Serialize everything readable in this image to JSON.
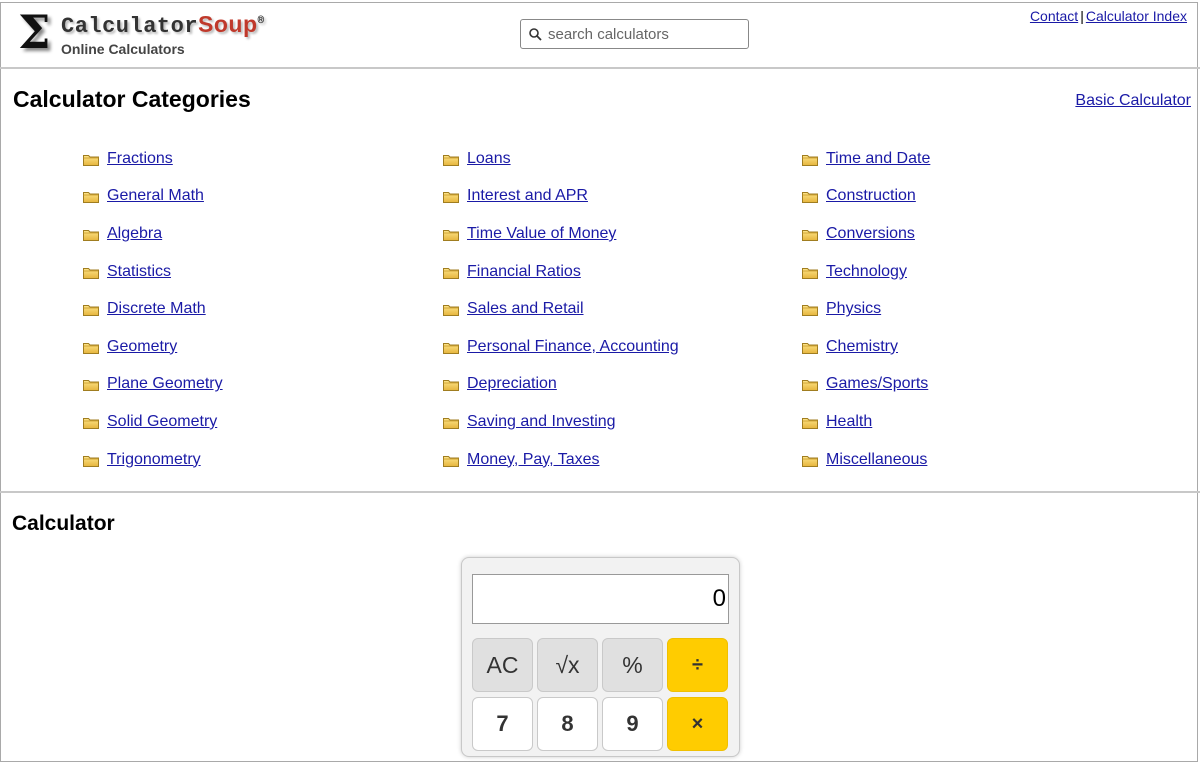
{
  "header": {
    "logo_name": "Calculator",
    "logo_soup": "Soup",
    "logo_reg": "®",
    "tagline": "Online Calculators",
    "search_placeholder": "search calculators",
    "contact": "Contact",
    "separator": "|",
    "index": "Calculator Index"
  },
  "categories": {
    "title": "Calculator Categories",
    "basic_link": "Basic Calculator",
    "columns": [
      [
        "Fractions",
        "General Math",
        "Algebra",
        "Statistics",
        "Discrete Math",
        "Geometry",
        "Plane Geometry",
        "Solid Geometry",
        "Trigonometry"
      ],
      [
        "Loans",
        "Interest and APR",
        "Time Value of Money",
        "Financial Ratios",
        "Sales and Retail",
        "Personal Finance, Accounting",
        "Depreciation",
        "Saving and Investing",
        "Money, Pay, Taxes"
      ],
      [
        "Time and Date",
        "Construction",
        "Conversions",
        "Technology",
        "Physics",
        "Chemistry",
        "Games/Sports",
        "Health",
        "Miscellaneous"
      ]
    ],
    "folder_icon": "folder-icon"
  },
  "calculator": {
    "title": "Calculator",
    "display": "0",
    "keys": [
      [
        "AC",
        "√x",
        "%",
        "÷"
      ],
      [
        "7",
        "8",
        "9",
        "×"
      ]
    ],
    "accent": "#ffcc00"
  }
}
